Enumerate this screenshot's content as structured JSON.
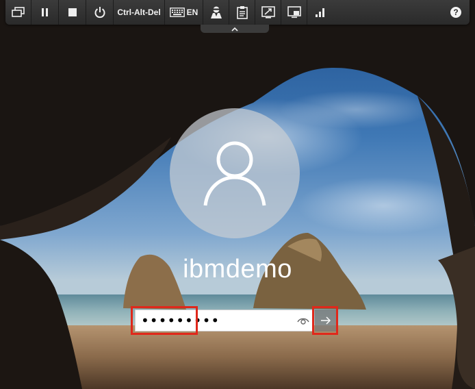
{
  "toolbar": {
    "items": [
      {
        "name": "monitors",
        "icon": "monitors-icon"
      },
      {
        "name": "pause",
        "icon": "pause-icon"
      },
      {
        "name": "stop",
        "icon": "stop-icon"
      },
      {
        "name": "power",
        "icon": "power-icon"
      },
      {
        "name": "ctrl-alt-del",
        "label": "Ctrl-Alt-Del"
      },
      {
        "name": "keyboard",
        "icon": "keyboard-icon",
        "label": "EN"
      },
      {
        "name": "credentials",
        "icon": "agent-icon"
      },
      {
        "name": "clipboard",
        "icon": "clipboard-icon"
      },
      {
        "name": "scale",
        "icon": "scale-icon"
      },
      {
        "name": "screens",
        "icon": "screens-icon"
      },
      {
        "name": "signal",
        "icon": "signal-bars-icon"
      },
      {
        "name": "help",
        "icon": "help-icon",
        "label": "?"
      }
    ],
    "collapse_icon": "chevron-up-icon"
  },
  "login": {
    "username": "ibmdemo",
    "password_masked": "•••••••••",
    "reveal_icon": "eye-icon",
    "submit_icon": "arrow-right-icon"
  },
  "highlight_color": "#e0281b"
}
